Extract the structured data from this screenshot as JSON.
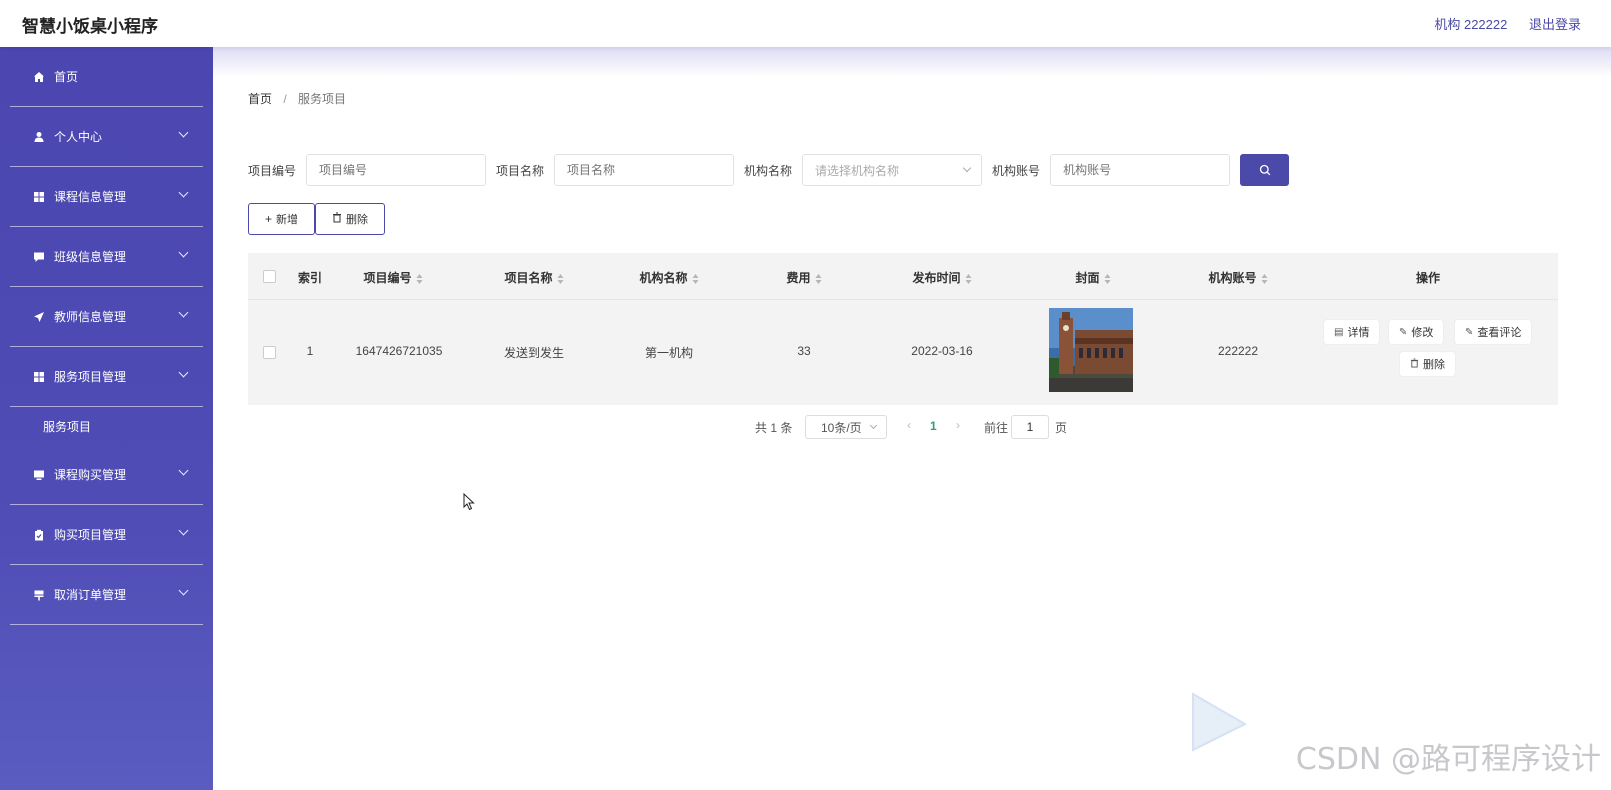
{
  "app": {
    "title": "智慧小饭桌小程序"
  },
  "topbar": {
    "user": "机构 222222",
    "logout": "退出登录"
  },
  "sidebar": {
    "items": [
      {
        "label": "首页",
        "icon": "home-icon"
      },
      {
        "label": "个人中心",
        "icon": "user-icon"
      },
      {
        "label": "课程信息管理",
        "icon": "grid-icon"
      },
      {
        "label": "班级信息管理",
        "icon": "chat-icon"
      },
      {
        "label": "教师信息管理",
        "icon": "send-icon"
      },
      {
        "label": "服务项目管理",
        "icon": "grid-icon"
      },
      {
        "label": "课程购买管理",
        "icon": "monitor-icon"
      },
      {
        "label": "购买项目管理",
        "icon": "clipboard-icon"
      },
      {
        "label": "取消订单管理",
        "icon": "flag-icon"
      }
    ],
    "submenu": {
      "label": "服务项目"
    }
  },
  "breadcrumb": {
    "home": "首页",
    "separator": "/",
    "current": "服务项目"
  },
  "search": {
    "fields": [
      {
        "label": "项目编号",
        "placeholder": "项目编号"
      },
      {
        "label": "项目名称",
        "placeholder": "项目名称"
      },
      {
        "label": "机构名称",
        "placeholder": "请选择机构名称"
      },
      {
        "label": "机构账号",
        "placeholder": "机构账号"
      }
    ]
  },
  "actions": {
    "add": "新增",
    "delete": "删除"
  },
  "table": {
    "headers": [
      "索引",
      "项目编号",
      "项目名称",
      "机构名称",
      "费用",
      "发布时间",
      "封面",
      "机构账号",
      "操作"
    ],
    "rows": [
      {
        "index": "1",
        "code": "1647426721035",
        "name": "发送到发生",
        "org": "第一机构",
        "fee": "33",
        "date": "2022-03-16",
        "account": "222222"
      }
    ],
    "row_actions": {
      "detail": "详情",
      "edit": "修改",
      "comments": "查看评论",
      "delete": "删除"
    }
  },
  "pagination": {
    "total": "共 1 条",
    "page_size": "10条/页",
    "current": "1",
    "goto_prefix": "前往",
    "goto_value": "1",
    "goto_suffix": "页"
  },
  "watermark": "CSDN @路可程序设计",
  "colors": {
    "accent": "#4b4aa8",
    "sidebar": "#4b46b0",
    "page_active": "#2e9e74"
  }
}
